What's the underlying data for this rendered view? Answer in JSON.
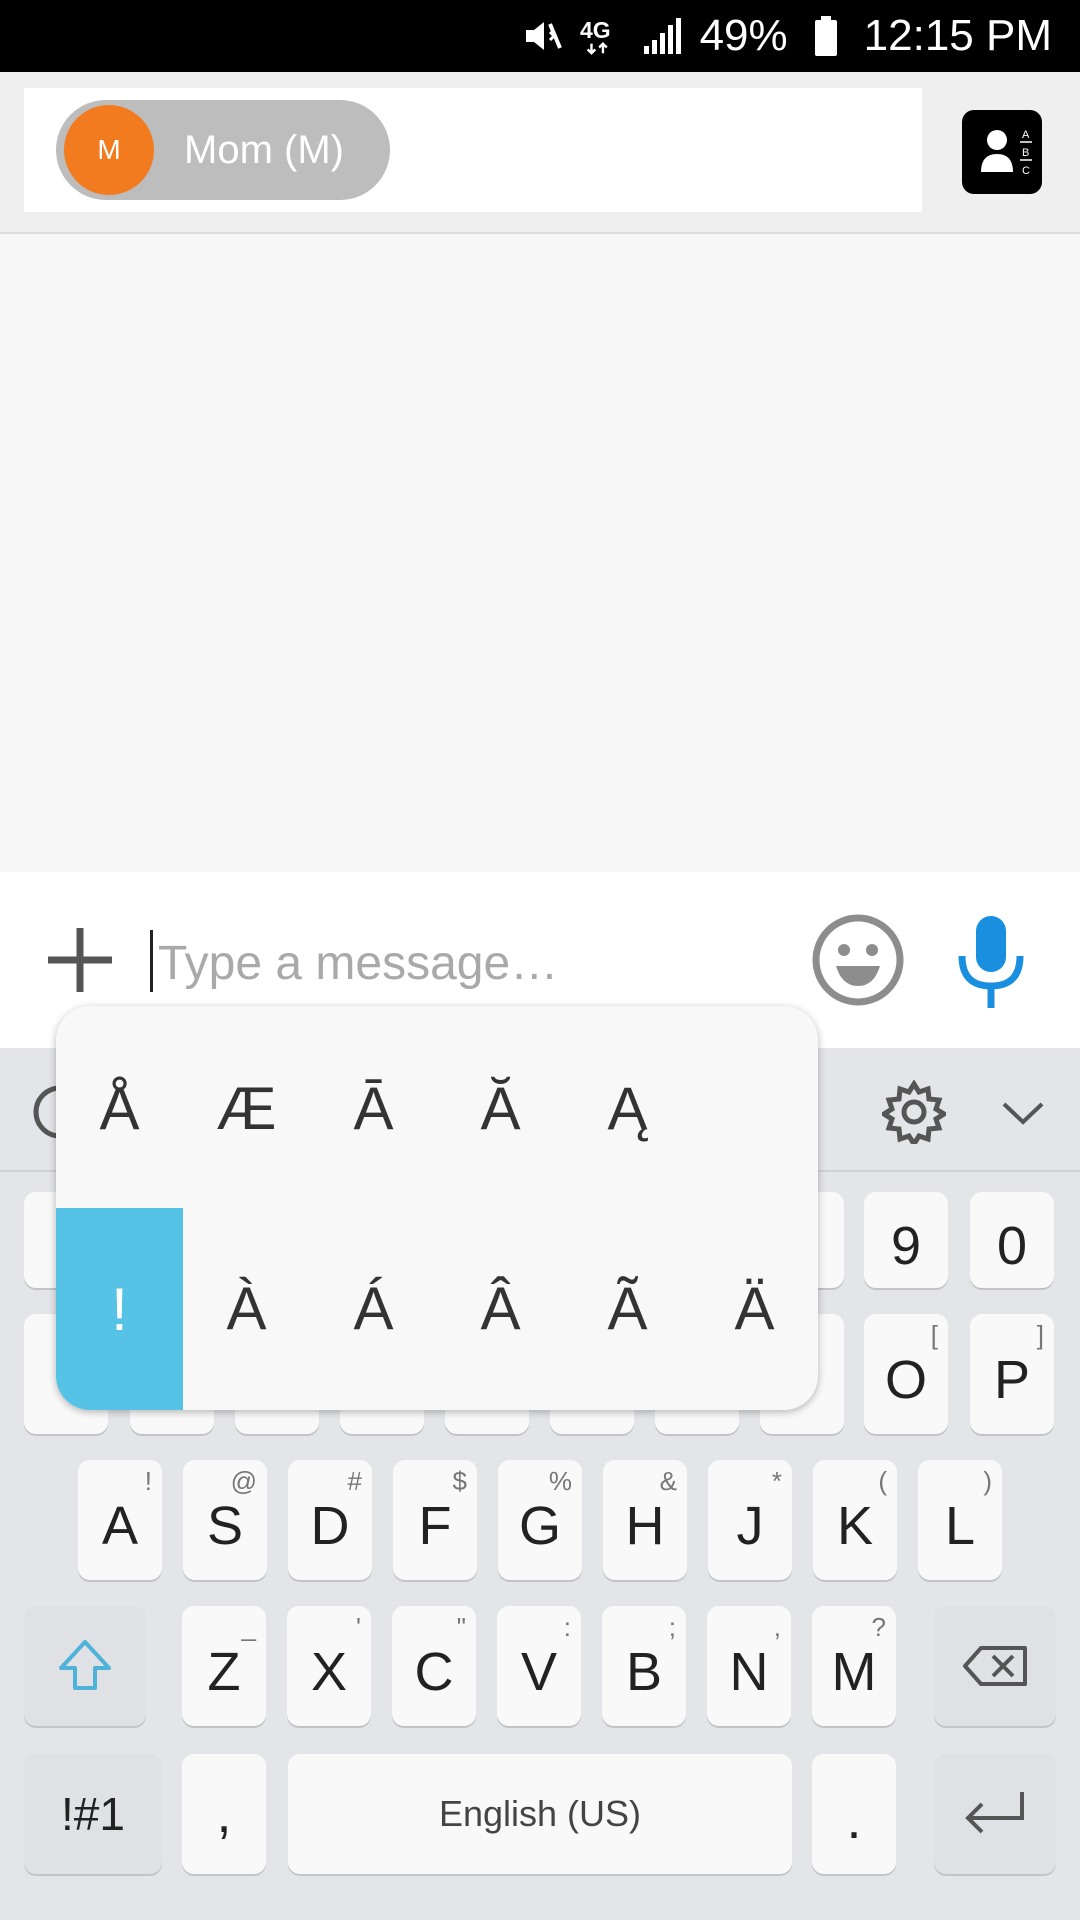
{
  "status_bar": {
    "battery_percent": "49%",
    "time": "12:15 PM",
    "network_label": "4G",
    "icons": [
      "mute-vibrate-icon",
      "network-4g-lte-icon",
      "signal-strength-icon",
      "battery-icon"
    ]
  },
  "recipient": {
    "avatar_initial": "M",
    "name": "Mom (M)",
    "avatar_color": "#f27b1f"
  },
  "composer": {
    "placeholder": "Type a message…",
    "icons": [
      "add-icon",
      "emoji-icon",
      "microphone-icon"
    ],
    "accent_color": "#1a8fe0"
  },
  "accent_popup": {
    "row1": [
      "Å",
      "Æ",
      "Ā",
      "Ă",
      "Ą"
    ],
    "row2": [
      "!",
      "À",
      "Á",
      "Â",
      "Ã",
      "Ä"
    ],
    "selected": "!",
    "selected_color": "#56c2e6"
  },
  "keyboard": {
    "row_numbers_visible": [
      "9",
      "0"
    ],
    "row_top_visible": [
      {
        "main": "O",
        "alt": "["
      },
      {
        "main": "P",
        "alt": "]"
      }
    ],
    "row_home": [
      {
        "main": "A",
        "alt": "!"
      },
      {
        "main": "S",
        "alt": "@"
      },
      {
        "main": "D",
        "alt": "#"
      },
      {
        "main": "F",
        "alt": "$"
      },
      {
        "main": "G",
        "alt": "%"
      },
      {
        "main": "H",
        "alt": "&"
      },
      {
        "main": "J",
        "alt": "*"
      },
      {
        "main": "K",
        "alt": "("
      },
      {
        "main": "L",
        "alt": ")"
      }
    ],
    "row_bottom": [
      {
        "main": "Z",
        "alt": "_"
      },
      {
        "main": "X",
        "alt": "'"
      },
      {
        "main": "C",
        "alt": "\""
      },
      {
        "main": "V",
        "alt": ":"
      },
      {
        "main": "B",
        "alt": ";"
      },
      {
        "main": "N",
        "alt": ","
      },
      {
        "main": "M",
        "alt": "?"
      }
    ],
    "symbols_label": "!#1",
    "comma_label": ",",
    "space_label": "English (US)",
    "period_label": ".",
    "shift_color": "#4fb2d9"
  }
}
